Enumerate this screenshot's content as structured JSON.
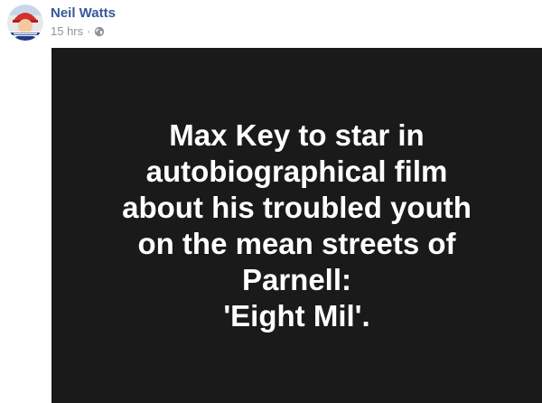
{
  "post": {
    "author": "Neil Watts",
    "timestamp": "15 hrs",
    "separator": "·",
    "privacy_icon": "globe-icon",
    "avatar_icon": "profile-avatar",
    "image": {
      "background": "#1a1a1a",
      "lines": [
        "Max Key to star in",
        "autobiographical film",
        "about his troubled youth",
        "on the mean streets of",
        "Parnell:",
        "'Eight Mil'."
      ]
    }
  },
  "colors": {
    "author_link": "#365899",
    "meta_gray": "#90949c",
    "image_bg": "#1a1a1a",
    "image_text": "#ffffff"
  }
}
